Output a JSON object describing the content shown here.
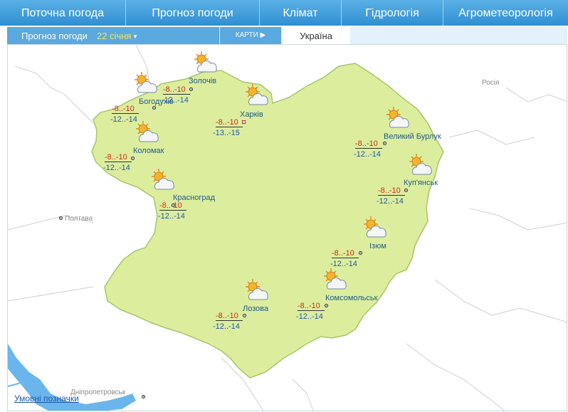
{
  "nav": {
    "tabs": [
      "Поточна погода",
      "Прогноз погоди",
      "Клімат",
      "Гідрологія",
      "Агрометеорологія"
    ]
  },
  "subnav": {
    "forecast_label": "Прогноз погоди",
    "date_label": "22 січня",
    "maps_label": "КАРТИ",
    "country_label": "Україна"
  },
  "map": {
    "region_fill": "#dcee9e",
    "water_color": "#6ab6ec",
    "neighbors": {
      "russia": "Росія",
      "poltava": "Полтава",
      "dnipro": "Дніпропетровськ"
    },
    "icon_names": [
      "partly-cloudy-icon"
    ],
    "stations": [
      {
        "name": "Золочів",
        "day": "",
        "night": ""
      },
      {
        "name": "Богодухів",
        "day": "-8..-10",
        "night": "-12..-14"
      },
      {
        "name": "",
        "day": "-8..-10",
        "night": "-12..-14"
      },
      {
        "name": "Харків",
        "day": "-8..-10",
        "night": "-13..-15"
      },
      {
        "name": "Коломак",
        "day": "-8..-10",
        "night": "-12..-14"
      },
      {
        "name": "Великий Бурлук",
        "day": "-8..-10",
        "night": "-12..-14"
      },
      {
        "name": "Красноград",
        "day": "-8..-10",
        "night": "-12..-14"
      },
      {
        "name": "Куп'янськ",
        "day": "-8..-10",
        "night": "-12..-14"
      },
      {
        "name": "Ізюм",
        "day": "-8..-10",
        "night": "-12..-14"
      },
      {
        "name": "Лозова",
        "day": "-8..-10",
        "night": "-12..-14"
      },
      {
        "name": "Комсомольськ",
        "day": "-8..-10",
        "night": "-12..-14"
      }
    ]
  },
  "legend": {
    "label": "Умовні позначки"
  }
}
